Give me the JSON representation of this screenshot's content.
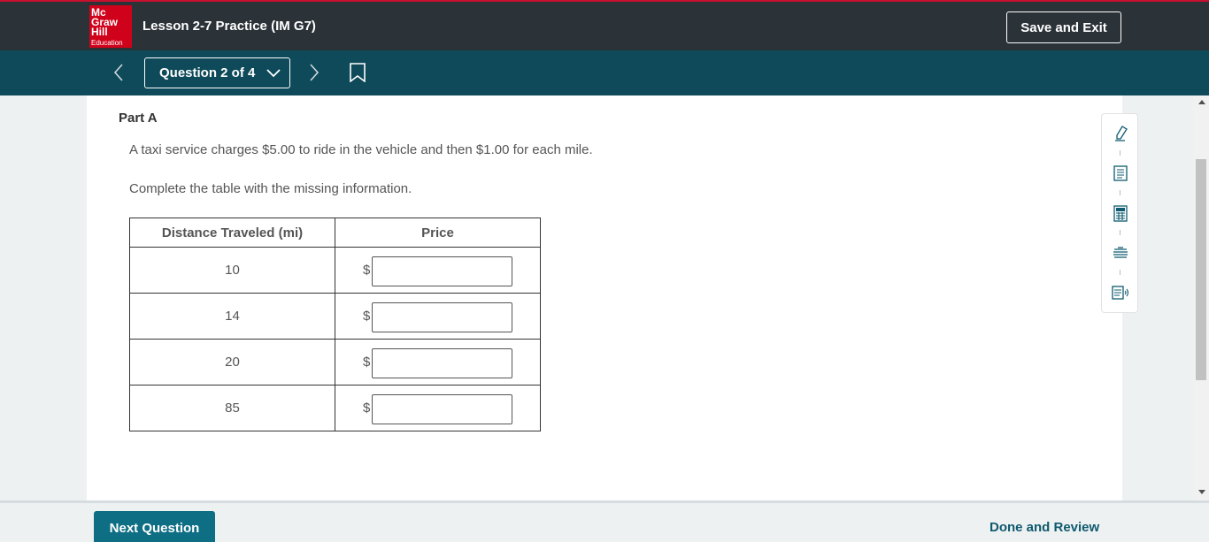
{
  "header": {
    "logo_lines": [
      "Mc",
      "Graw",
      "Hill",
      "Education"
    ],
    "lesson_title": "Lesson 2-7 Practice (IM G7)",
    "save_exit_label": "Save and Exit",
    "brand_red": "#d0021b"
  },
  "nav": {
    "question_label": "Question 2 of 4",
    "prev_icon": "chevron-left-icon",
    "next_icon": "chevron-right-icon",
    "bookmark_icon": "bookmark-icon"
  },
  "content": {
    "part_title": "Part A",
    "prompt_text": "A taxi service charges $5.00 to ride in the vehicle and then $1.00 for each mile.",
    "instruction_text": "Complete the table with the missing information."
  },
  "table": {
    "headers": [
      "Distance Traveled (mi)",
      "Price"
    ],
    "currency_symbol": "$",
    "rows": [
      {
        "distance": "10",
        "price": ""
      },
      {
        "distance": "14",
        "price": ""
      },
      {
        "distance": "20",
        "price": ""
      },
      {
        "distance": "85",
        "price": ""
      }
    ]
  },
  "tools": [
    "highlighter-icon",
    "notepad-icon",
    "calculator-icon",
    "line-reader-icon",
    "text-to-speech-icon"
  ],
  "footer": {
    "next_label": "Next Question",
    "done_label": "Done and Review",
    "accent": "#0e6e84"
  }
}
